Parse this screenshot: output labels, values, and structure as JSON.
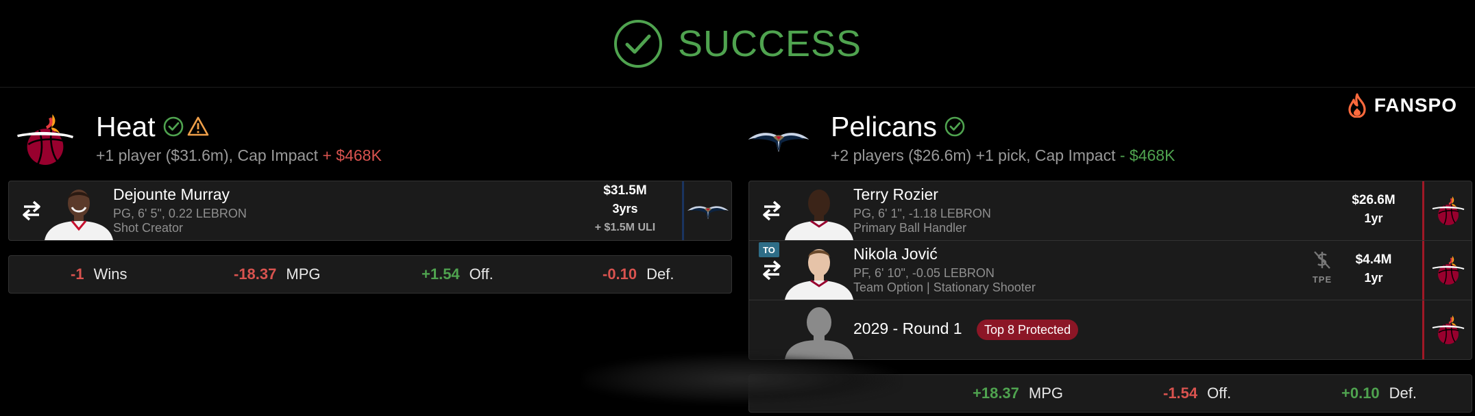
{
  "header": {
    "title": "SUCCESS"
  },
  "brand": {
    "name": "FANSPO"
  },
  "teams": {
    "left": {
      "name": "Heat",
      "summary_prefix": "+1 player ($31.6m), Cap Impact ",
      "summary_impact": "+ $468K",
      "status_icons": [
        "check-circle-icon",
        "warning-icon"
      ]
    },
    "right": {
      "name": "Pelicans",
      "summary_prefix": "+2 players ($26.6m) +1 pick, Cap Impact ",
      "summary_impact": "- $468K",
      "status_icons": [
        "check-circle-icon"
      ]
    }
  },
  "left_players": [
    {
      "name": "Dejounte Murray",
      "info": "PG, 6' 5\", 0.22 LEBRON",
      "role": "Shot Creator",
      "salary": "$31.5M",
      "years": "3yrs",
      "extra": "+ $1.5M ULI",
      "destination": "pelicans-logo-icon"
    }
  ],
  "left_stats": [
    {
      "value": "-1",
      "label": "Wins",
      "tone": "neg"
    },
    {
      "value": "-18.37",
      "label": "MPG",
      "tone": "neg"
    },
    {
      "value": "+1.54",
      "label": "Off.",
      "tone": "pos"
    },
    {
      "value": "-0.10",
      "label": "Def.",
      "tone": "neg"
    }
  ],
  "right_players": [
    {
      "name": "Terry Rozier",
      "info": "PG, 6' 1\", -1.18 LEBRON",
      "role": "Primary Ball Handler",
      "salary": "$26.6M",
      "years": "1yr",
      "destination": "heat-logo-icon"
    },
    {
      "badge": "TO",
      "name": "Nikola Jović",
      "info": "PF, 6' 10\", -0.05 LEBRON",
      "role": "Team Option | Stationary Shooter",
      "tpe_label": "TPE",
      "salary": "$4.4M",
      "years": "1yr",
      "destination": "heat-logo-icon"
    }
  ],
  "right_pick": {
    "label": "2029 - Round 1",
    "protection": "Top 8 Protected",
    "destination": "heat-logo-icon"
  },
  "right_stats": [
    {
      "value": "+18.37",
      "label": "MPG",
      "tone": "pos"
    },
    {
      "value": "-1.54",
      "label": "Off.",
      "tone": "neg"
    },
    {
      "value": "+0.10",
      "label": "Def.",
      "tone": "pos"
    }
  ],
  "colors": {
    "positive": "#4fa34f",
    "negative": "#d9534f",
    "heat": "#98002e",
    "pelicans": "#0c2340",
    "pelicans_gold": "#c8102e"
  }
}
